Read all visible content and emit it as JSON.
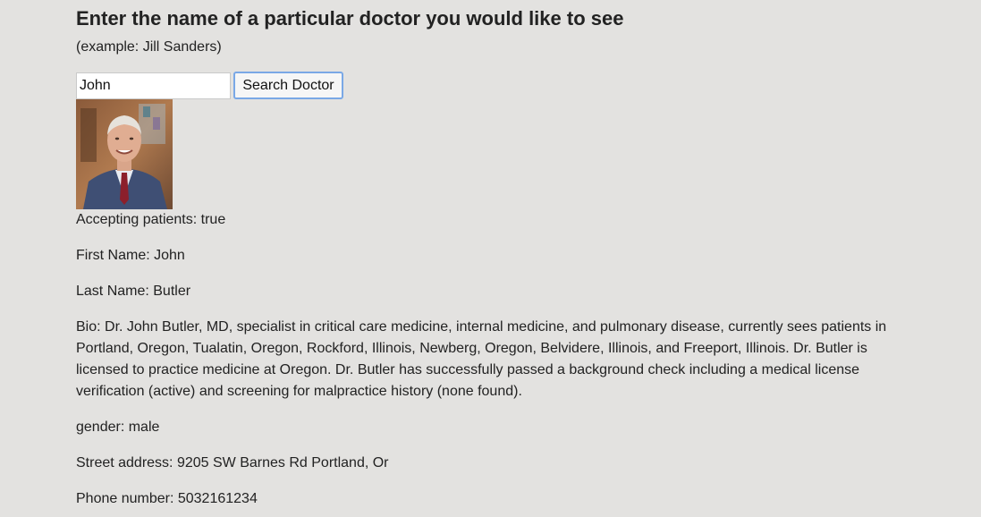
{
  "heading": "Enter the name of a particular doctor you would like to see",
  "example": "(example: Jill Sanders)",
  "search": {
    "value": "John",
    "button_label": "Search Doctor"
  },
  "doctor": {
    "accepting": "Accepting patients: true",
    "first_name": "First Name: John",
    "last_name": "Last Name: Butler",
    "bio": "Bio: Dr. John Butler, MD, specialist in critical care medicine, internal medicine, and pulmonary disease, currently sees patients in Portland, Oregon, Tualatin, Oregon, Rockford, Illinois, Newberg, Oregon, Belvidere, Illinois, and Freeport, Illinois. Dr. Butler is licensed to practice medicine at Oregon. Dr. Butler has successfully passed a background check including a medical license verification (active) and screening for malpractice history (none found).",
    "gender": "gender: male",
    "address": "Street address: 9205 SW Barnes Rd Portland, Or",
    "phone": "Phone number: 5032161234"
  }
}
